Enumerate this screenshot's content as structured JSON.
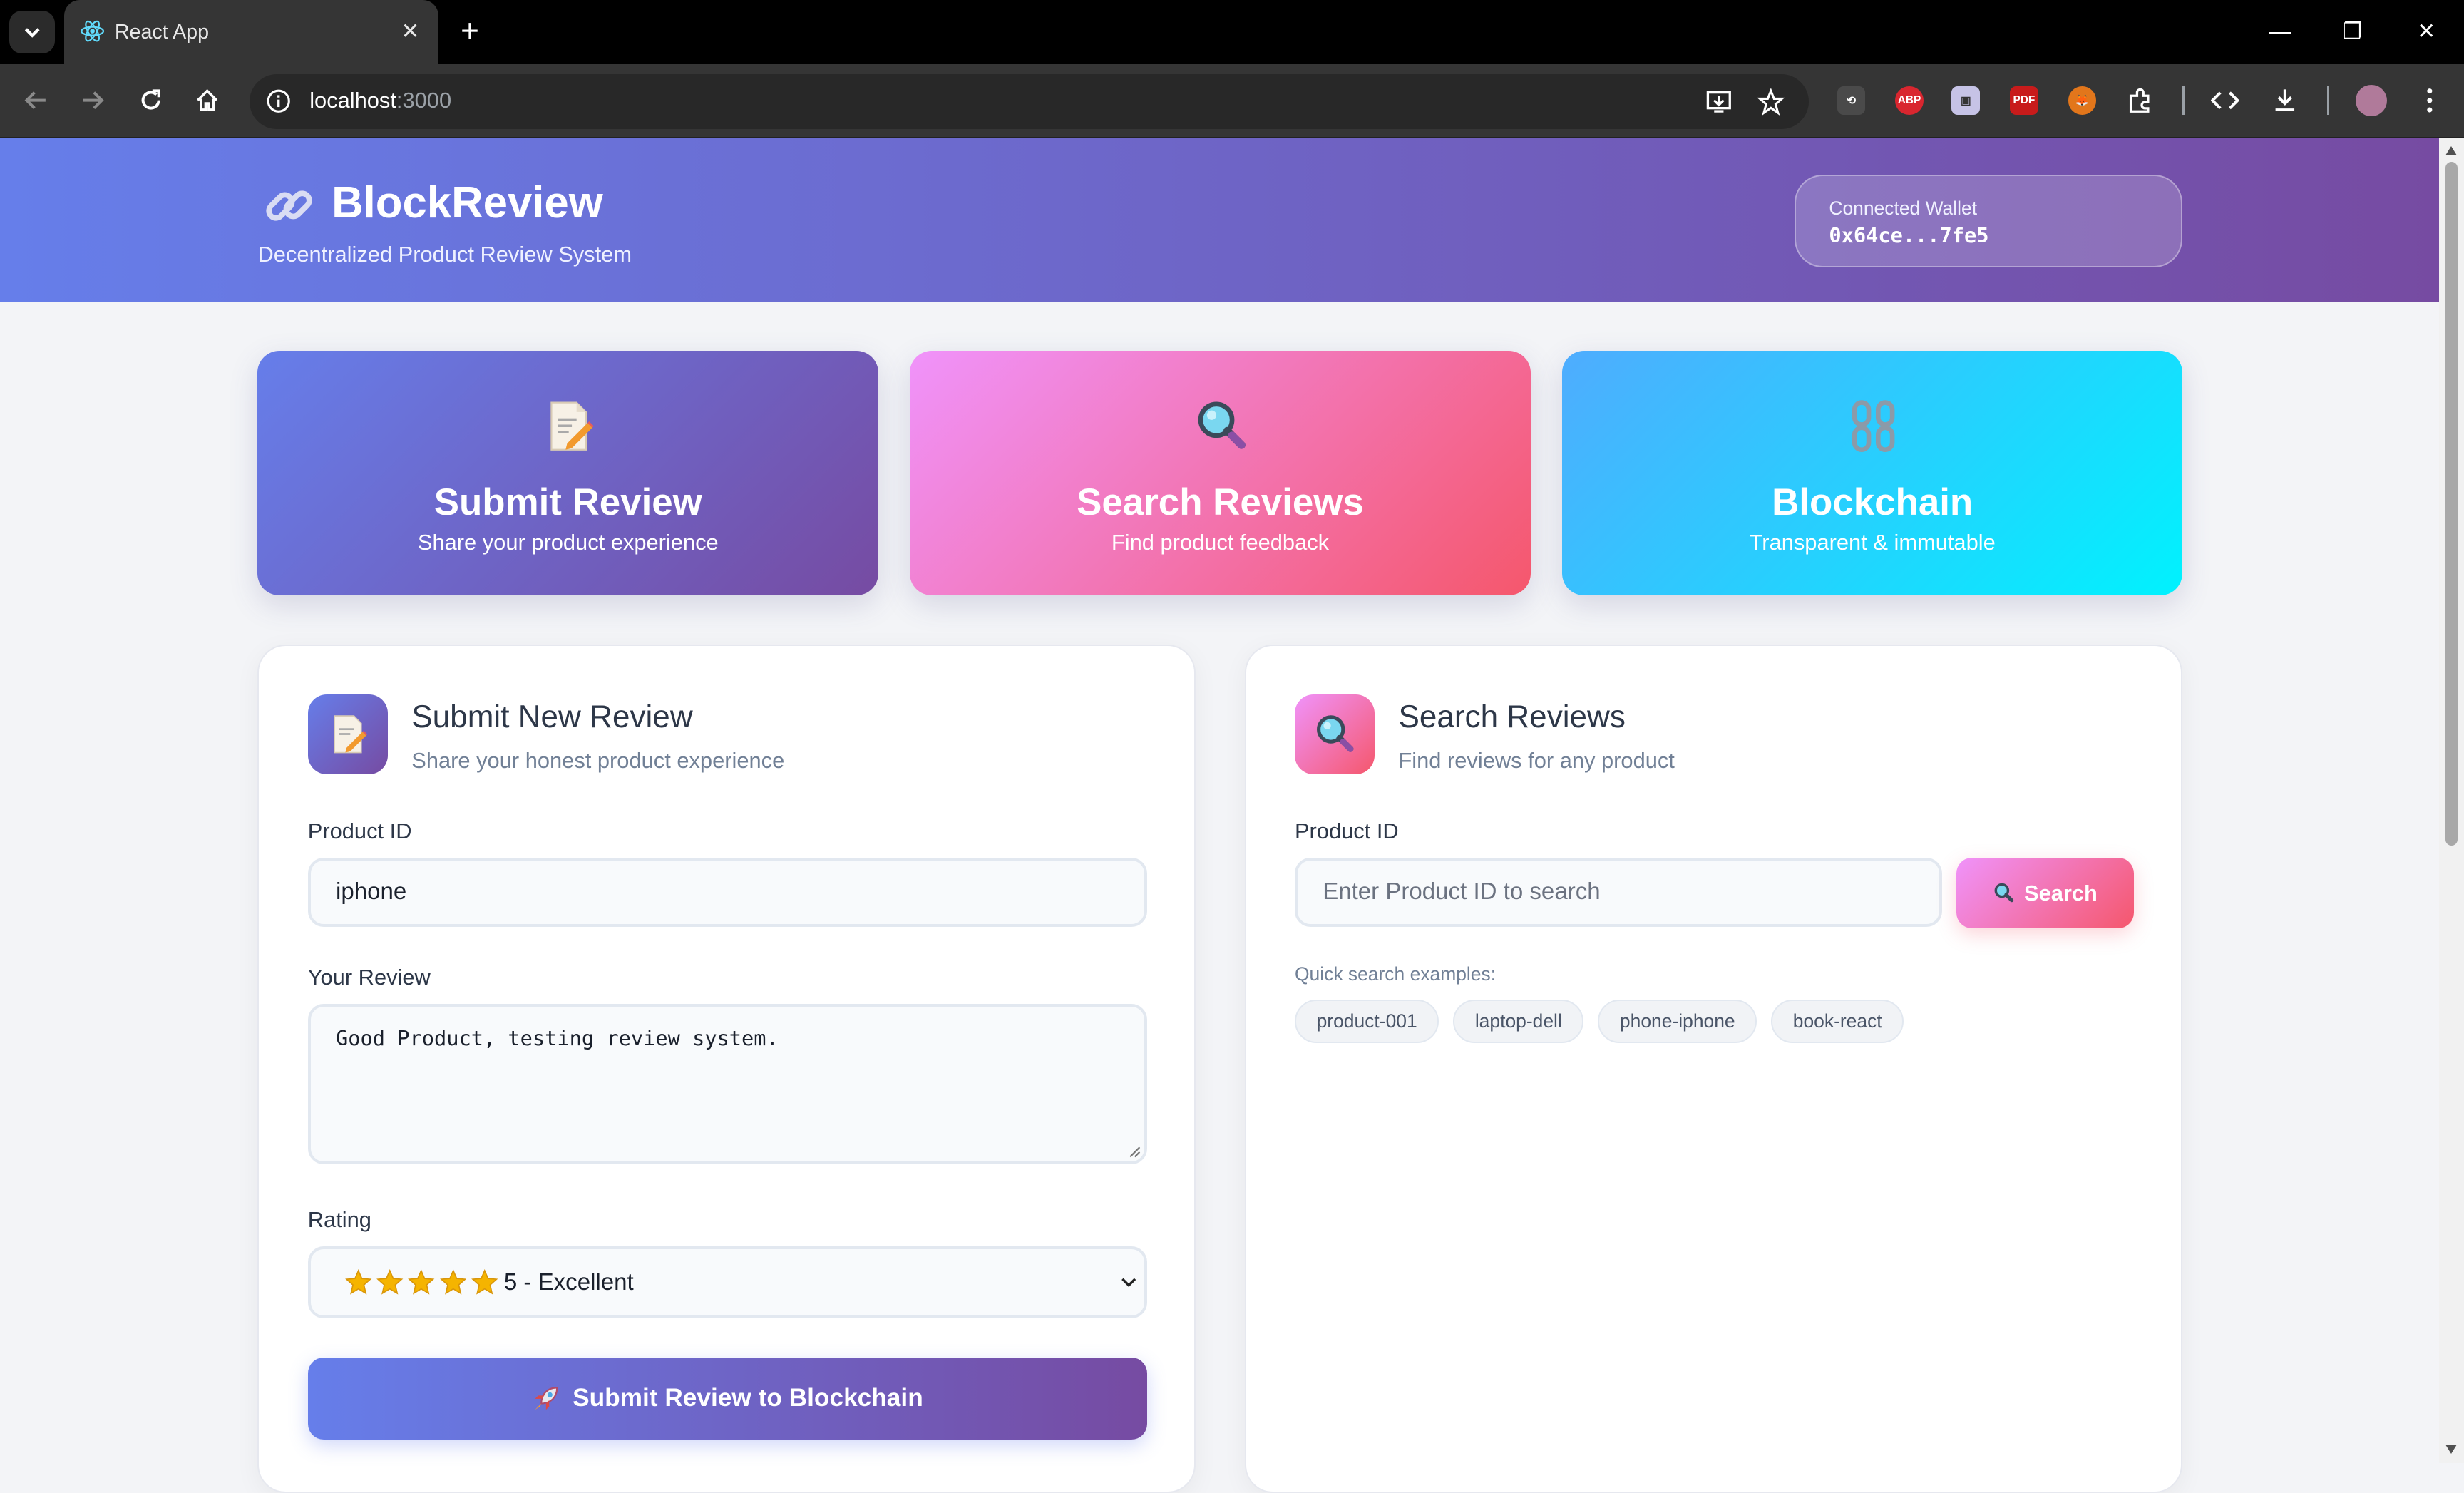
{
  "browser": {
    "tab_title": "React App",
    "url_host": "localhost",
    "url_port": ":3000"
  },
  "header": {
    "title": "BlockReview",
    "subtitle": "Decentralized Product Review System",
    "wallet_label": "Connected Wallet",
    "wallet_address": "0x64ce...7fe5"
  },
  "features": [
    {
      "title": "Submit Review",
      "subtitle": "Share your product experience",
      "icon": "memo-icon"
    },
    {
      "title": "Search Reviews",
      "subtitle": "Find product feedback",
      "icon": "magnifier-icon"
    },
    {
      "title": "Blockchain",
      "subtitle": "Transparent & immutable",
      "icon": "chain-icon"
    }
  ],
  "submit_panel": {
    "title": "Submit New Review",
    "subtitle": "Share your honest product experience",
    "product_label": "Product ID",
    "product_value": "iphone",
    "review_label": "Your Review",
    "review_value": "Good Product, testing review system.",
    "rating_label": "Rating",
    "rating_value": "5 - Excellent",
    "rating_stars": 5,
    "submit_label": "Submit Review to Blockchain"
  },
  "search_panel": {
    "title": "Search Reviews",
    "subtitle": "Find reviews for any product",
    "product_label": "Product ID",
    "search_placeholder": "Enter Product ID to search",
    "search_label": "Search",
    "quick_label": "Quick search examples:",
    "examples": [
      "product-001",
      "laptop-dell",
      "phone-iphone",
      "book-react"
    ]
  },
  "colors": {
    "header_gradient": [
      "#667eea",
      "#764ba2"
    ],
    "search_gradient": [
      "#f093fb",
      "#f5576c"
    ],
    "blockchain_gradient": [
      "#4facfe",
      "#00f2fe"
    ]
  }
}
